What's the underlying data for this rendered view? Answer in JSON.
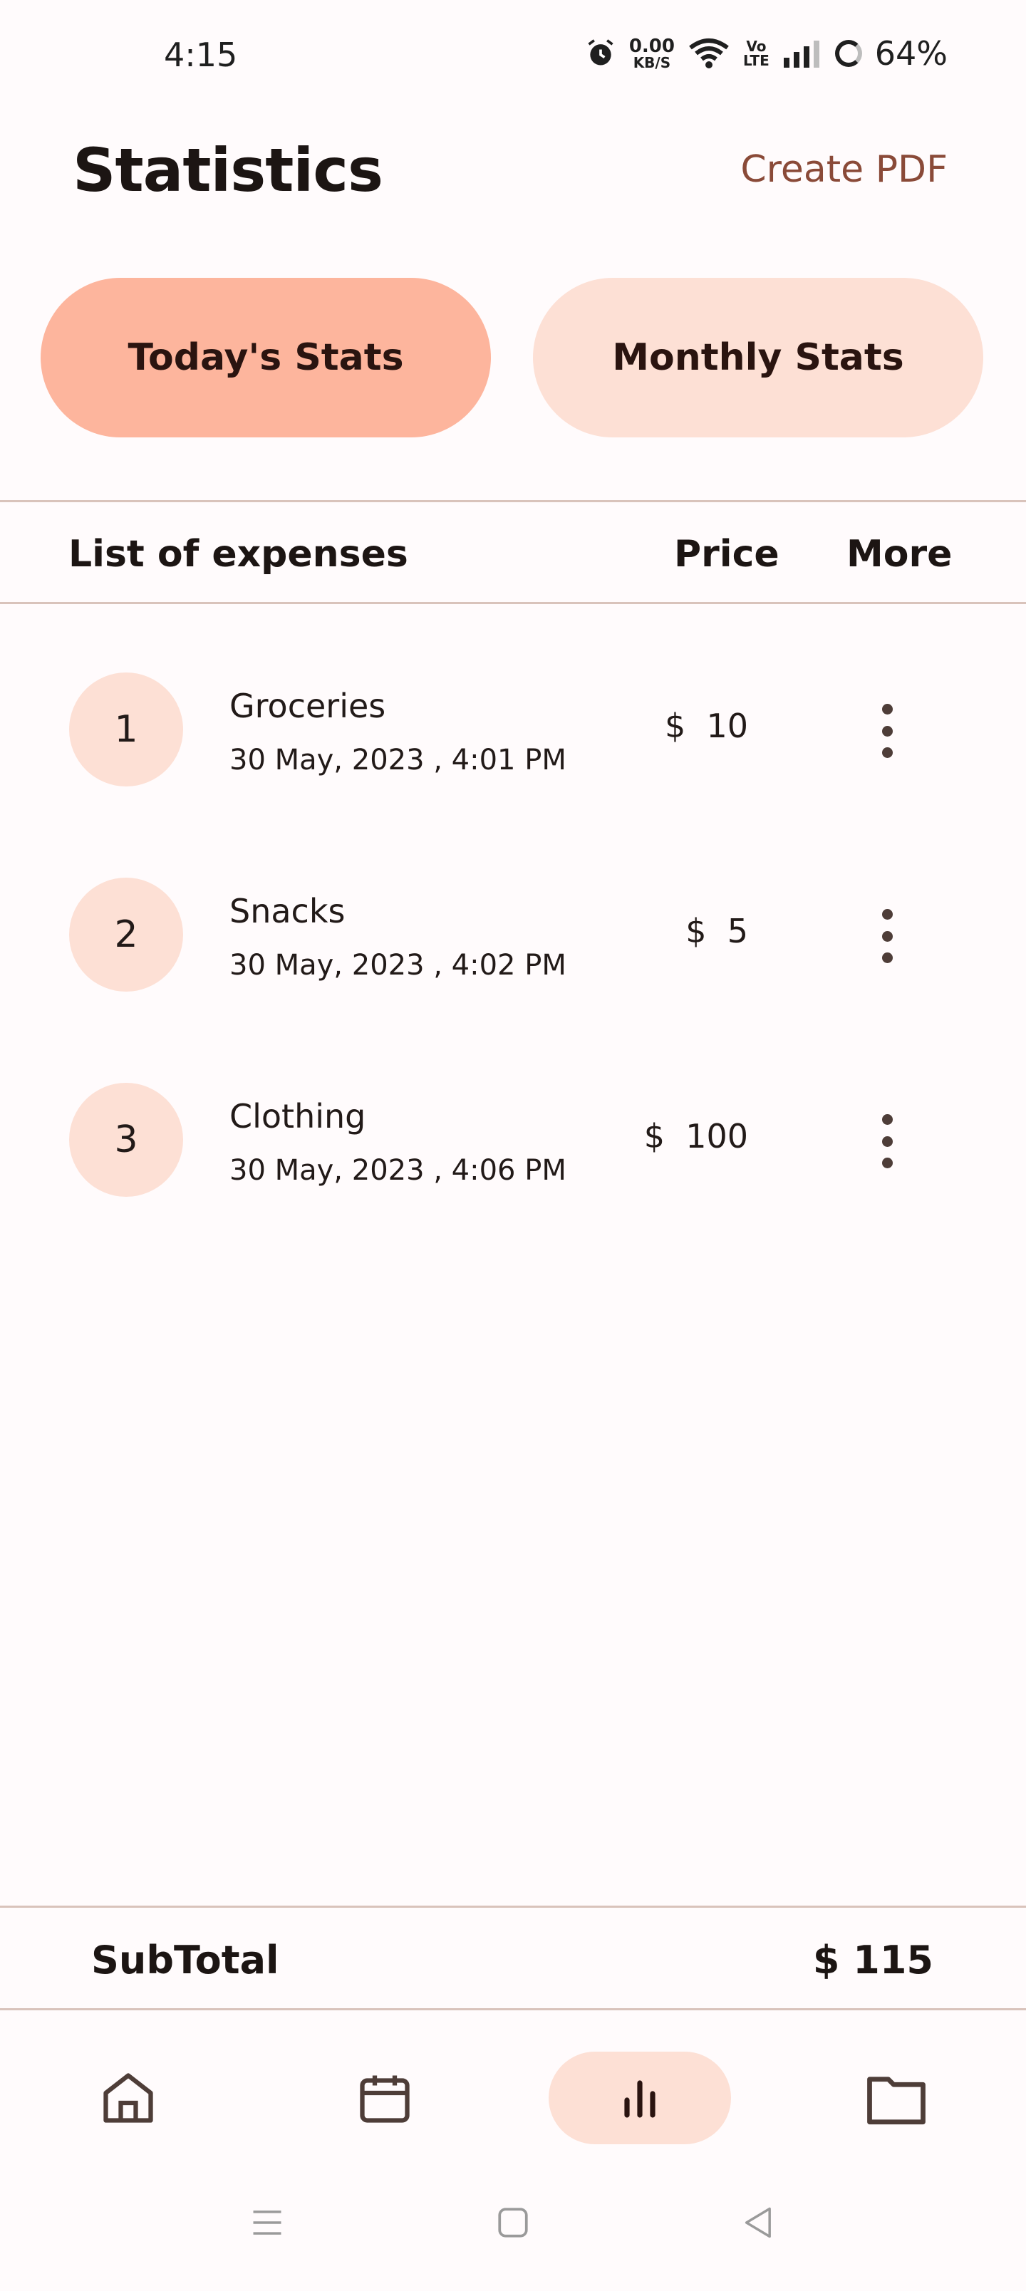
{
  "status_bar": {
    "time": "4:15",
    "net_speed_value": "0.00",
    "net_speed_unit": "KB/S",
    "volte_top": "Vo",
    "volte_bottom": "LTE",
    "battery": "64%"
  },
  "header": {
    "title": "Statistics",
    "create_pdf": "Create PDF"
  },
  "tabs": [
    {
      "label": "Today's Stats",
      "active": true
    },
    {
      "label": "Monthly Stats",
      "active": false
    }
  ],
  "table": {
    "headers": {
      "list": "List of expenses",
      "price": "Price",
      "more": "More"
    },
    "rows": [
      {
        "index": "1",
        "name": "Groceries",
        "date": "30 May, 2023 , 4:01 PM",
        "price": "$  10"
      },
      {
        "index": "2",
        "name": "Snacks",
        "date": "30 May, 2023 , 4:02 PM",
        "price": "$  5"
      },
      {
        "index": "3",
        "name": "Clothing",
        "date": "30 May, 2023 , 4:06 PM",
        "price": "$  100"
      }
    ]
  },
  "subtotal": {
    "label": "SubTotal",
    "value": "$ 115"
  },
  "bottom_nav": [
    {
      "icon": "home-icon",
      "active": false
    },
    {
      "icon": "calendar-icon",
      "active": false
    },
    {
      "icon": "bar-chart-icon",
      "active": true
    },
    {
      "icon": "folder-icon",
      "active": false
    }
  ],
  "system_nav": [
    "menu-icon",
    "home-square-icon",
    "back-icon"
  ],
  "colors": {
    "background": "#fffbfc",
    "accent_active": "#fdb59d",
    "accent_soft": "#fde0d5",
    "link": "#8a4a38"
  }
}
